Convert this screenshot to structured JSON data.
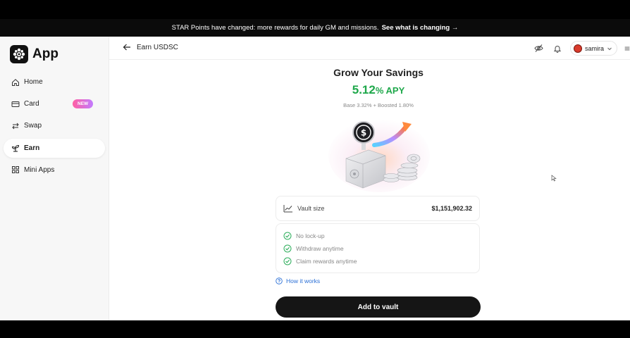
{
  "banner": {
    "text": "STAR Points have changed: more rewards for daily GM and missions.",
    "link": "See what is changing →"
  },
  "sidebar": {
    "logo_text": "App",
    "items": [
      {
        "label": "Home",
        "icon": "home-icon"
      },
      {
        "label": "Card",
        "icon": "card-icon",
        "badge": "NEW"
      },
      {
        "label": "Swap",
        "icon": "swap-icon"
      },
      {
        "label": "Earn",
        "icon": "earn-icon",
        "active": true
      },
      {
        "label": "Mini Apps",
        "icon": "grid-icon"
      }
    ]
  },
  "header": {
    "back_label": "Earn USDSC",
    "username": "samira",
    "icons": [
      "eye-off-icon",
      "bell-icon",
      "menu-icon"
    ]
  },
  "main": {
    "title": "Grow Your Savings",
    "apy_value": "5.12",
    "apy_unit": "% APY",
    "apy_breakdown": "Base 3.32% + Boosted 1.80%",
    "vault_label": "Vault size",
    "vault_value": "$1,151,902.32",
    "features": [
      "No lock-up",
      "Withdraw anytime",
      "Claim rewards anytime"
    ],
    "how_it_works": "How it works",
    "cta_label": "Add to vault"
  },
  "colors": {
    "accent_green": "#1fa84b",
    "link_blue": "#2a6fd6",
    "button_dark": "#151515"
  }
}
